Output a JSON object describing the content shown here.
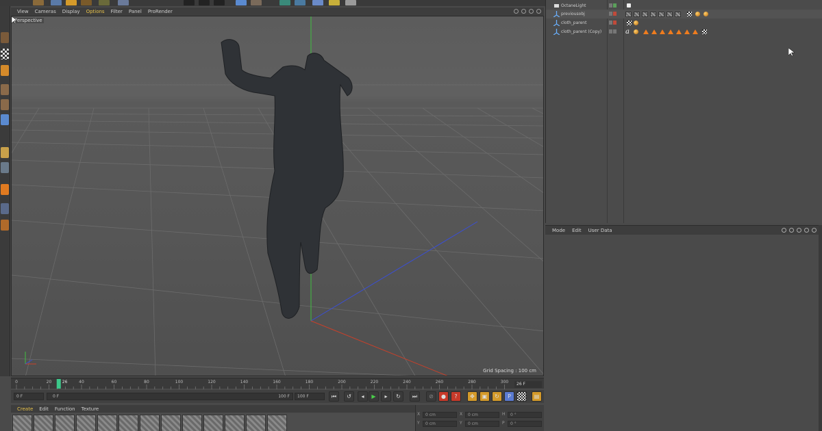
{
  "viewport": {
    "menu": [
      "View",
      "Cameras",
      "Display",
      "Options",
      "Filter",
      "Panel",
      "ProRender"
    ],
    "active_menu": "Options",
    "label": "Perspective",
    "grid_spacing": "Grid Spacing : 100 cm"
  },
  "timeline": {
    "ticks": [
      "0",
      "20",
      "40",
      "60",
      "80",
      "100",
      "120",
      "140",
      "160",
      "180",
      "200",
      "220",
      "240",
      "260",
      "280",
      "300"
    ],
    "current_frame_marker": "26",
    "current_frame": "26 F"
  },
  "transport": {
    "start_field": "0 F",
    "range_start": "0 F",
    "range_end": "100 F",
    "end_field": "100 F"
  },
  "materials": {
    "menu": [
      "Create",
      "Edit",
      "Function",
      "Texture"
    ],
    "active_menu": "Create",
    "swatch_count": 13
  },
  "coordinates": {
    "rows": [
      {
        "a": "X",
        "va": "0 cm",
        "b": "X",
        "vb": "0 cm",
        "c": "H",
        "vc": "0 °"
      },
      {
        "a": "Y",
        "va": "0 cm",
        "b": "Y",
        "vb": "0 cm",
        "c": "P",
        "vc": "0 °"
      }
    ]
  },
  "object_manager": {
    "objects": [
      {
        "name": "OctaneLight",
        "icon": "light-icon",
        "selected": false
      },
      {
        "name": "previousobj",
        "icon": "null-icon",
        "selected": true
      },
      {
        "name": "cloth_parent",
        "icon": "null-icon",
        "selected": false
      },
      {
        "name": "cloth_parent (Copy)",
        "icon": "null-icon",
        "selected": false
      }
    ]
  },
  "attribute_manager": {
    "menu": [
      "Mode",
      "Edit",
      "User Data"
    ]
  },
  "colors": {
    "accent": "#e8c24a",
    "tag_orange": "#ef7c1e",
    "axis_green": "#3fbf3f",
    "axis_blue": "#3a4fd8",
    "axis_red": "#c8402a"
  }
}
